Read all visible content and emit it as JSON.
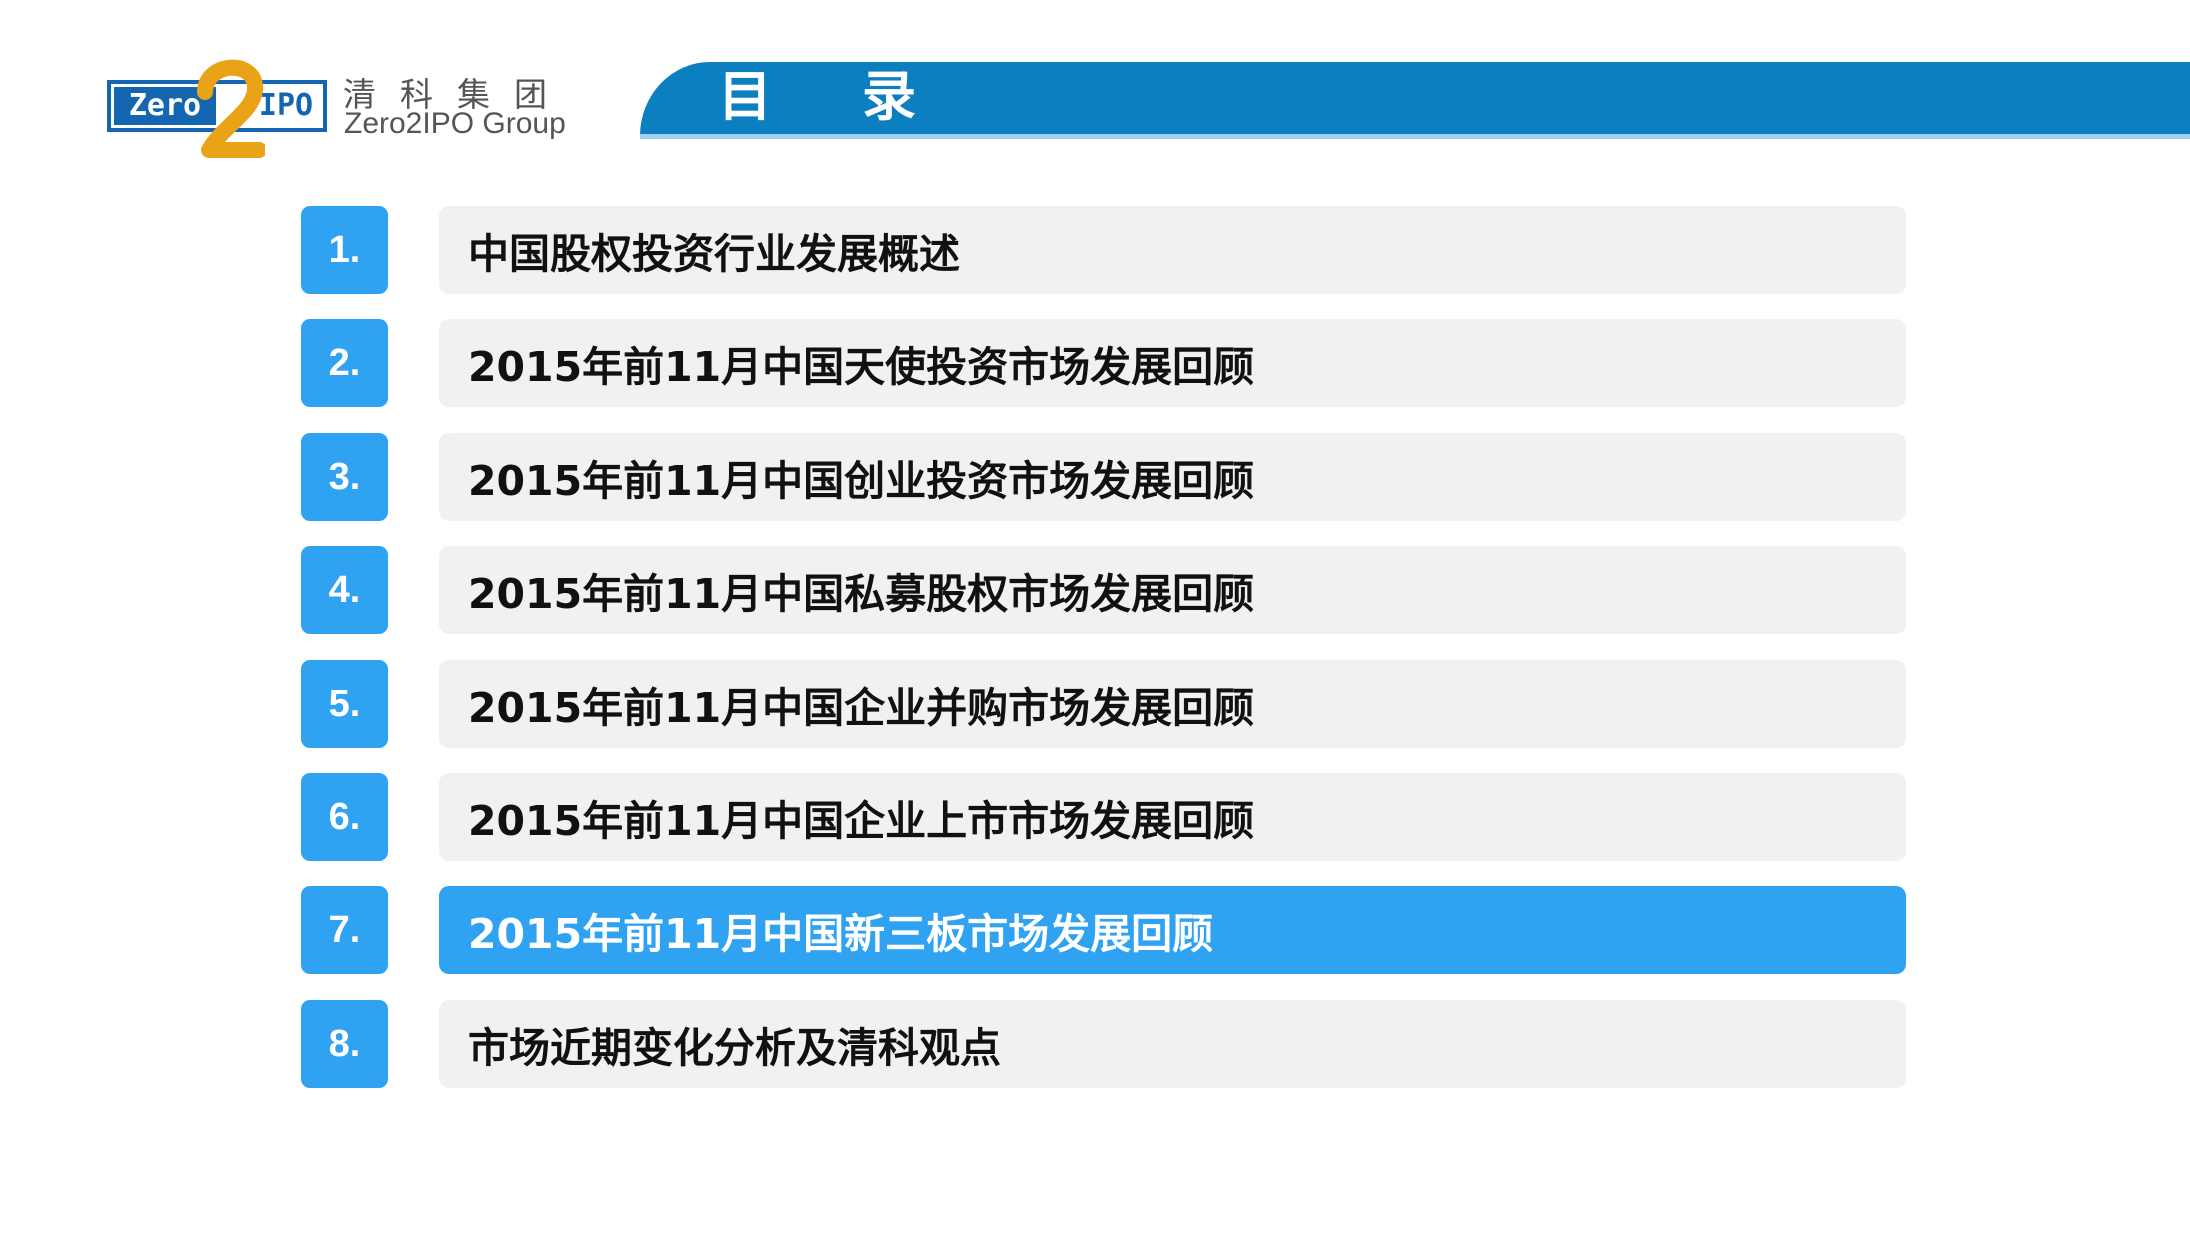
{
  "header": {
    "logo": {
      "zero_text": "Zero",
      "two_text": "2",
      "ipo_text": "IPO",
      "company_cn": "清科集团",
      "company_en": "Zero2IPO Group"
    },
    "title": "目录"
  },
  "colors": {
    "accent": "#2fa3f2",
    "title_bar": "#0c7fc1",
    "logo_blue": "#1566b0",
    "logo_gold": "#e8a317",
    "row_bg": "#f1f1f1"
  },
  "toc": {
    "items": [
      {
        "num": "1.",
        "label": "中国股权投资行业发展概述",
        "active": false
      },
      {
        "num": "2.",
        "label": "2015年前11月中国天使投资市场发展回顾",
        "active": false
      },
      {
        "num": "3.",
        "label": "2015年前11月中国创业投资市场发展回顾",
        "active": false
      },
      {
        "num": "4.",
        "label": "2015年前11月中国私募股权市场发展回顾",
        "active": false
      },
      {
        "num": "5.",
        "label": "2015年前11月中国企业并购市场发展回顾",
        "active": false
      },
      {
        "num": "6.",
        "label": "2015年前11月中国企业上市市场发展回顾",
        "active": false
      },
      {
        "num": "7.",
        "label": "2015年前11月中国新三板市场发展回顾",
        "active": true
      },
      {
        "num": "8.",
        "label": "市场近期变化分析及清科观点",
        "active": false
      }
    ]
  }
}
